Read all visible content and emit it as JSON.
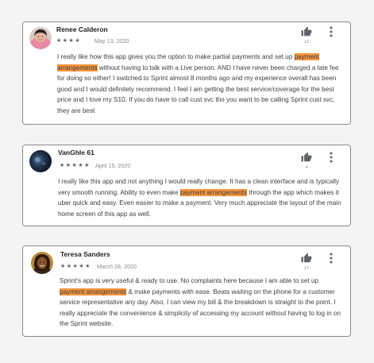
{
  "reviews": [
    {
      "name": "Renee Calderon",
      "stars": "★★★★",
      "date": "May 13, 2020",
      "likes": "12",
      "text_before": "I really like how this app gives you the option to make partial payments and set up ",
      "highlight": "payment arrangements",
      "text_after": " without having to talk with a Live person. AND I have never been charged a late fee for doing so either! I switched to Sprint almost 8 months ago and my experience overall has been good and I would definitely recommend. I feel I am getting the best service/coverage for the best price and I love my S10. If you do have to call cust svc tho you want to be calling Sprint cust svc, they are best"
    },
    {
      "name": "VanGhle 61",
      "stars": "★★★★★",
      "date": "April 15, 2020",
      "likes": "4",
      "text_before": "I really like this app and not anything I would really change.   It has a clean interface and is typically very smooth running. Ability to even make ",
      "highlight": "payment arrangements",
      "text_after": " through the app which makes it uber quick and easy. Even easier to make a payment. Very much appreciate the layout of the main home screen of this app as well."
    },
    {
      "name": "Teresa Sanders",
      "stars": "★★★★★",
      "date": "March 28, 2020",
      "likes": "17",
      "text_before": "Sprint's app is very useful & ready to use. No complaints here because I am able to set up ",
      "highlight": "payment arrangements",
      "text_after": " & make payments with ease. Beats waiting on the phone for a customer service representative any day. Also, I can view my bill & the breakdown is straight to the point. I really appreciate the convenience & simplicity of accessing my account without having to log in on the Sprint website."
    }
  ],
  "colors": {
    "highlight": "#f8963c",
    "border": "#8a8a8a",
    "background": "#f4f4f4"
  },
  "icons": {
    "like": "thumb-up-icon",
    "menu": "more-vert-icon"
  }
}
